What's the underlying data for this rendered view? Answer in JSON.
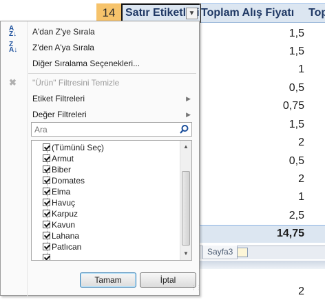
{
  "sheet": {
    "header_row_number": "14",
    "header_col_a": "Satır Etiketleri",
    "header_col_b": "Toplam Alış Fiyatı",
    "header_col_c_partial": "Top",
    "values": [
      "1,5",
      "1,5",
      "1",
      "0,5",
      "0,75",
      "1,5",
      "2",
      "0,5",
      "2",
      "1",
      "2,5"
    ],
    "total": "14,75",
    "below_value": "2",
    "sheet_tab": "Sayfa3"
  },
  "menu": {
    "sort_az": "A'dan Z'ye Sırala",
    "sort_za": "Z'den A'ya Sırala",
    "more_sort": "Diğer Sıralama Seçenekleri...",
    "clear_filter": "\"Ürün\" Filtresini Temizle",
    "label_filters": "Etiket Filtreleri",
    "value_filters": "Değer Filtreleri",
    "search_placeholder": "Ara",
    "list_items": [
      "(Tümünü Seç)",
      "Armut",
      "Biber",
      "Domates",
      "Elma",
      "Havuç",
      "Karpuz",
      "Kavun",
      "Lahana",
      "Patlıcan"
    ],
    "ok_button": "Tamam",
    "cancel_button": "İptal"
  }
}
